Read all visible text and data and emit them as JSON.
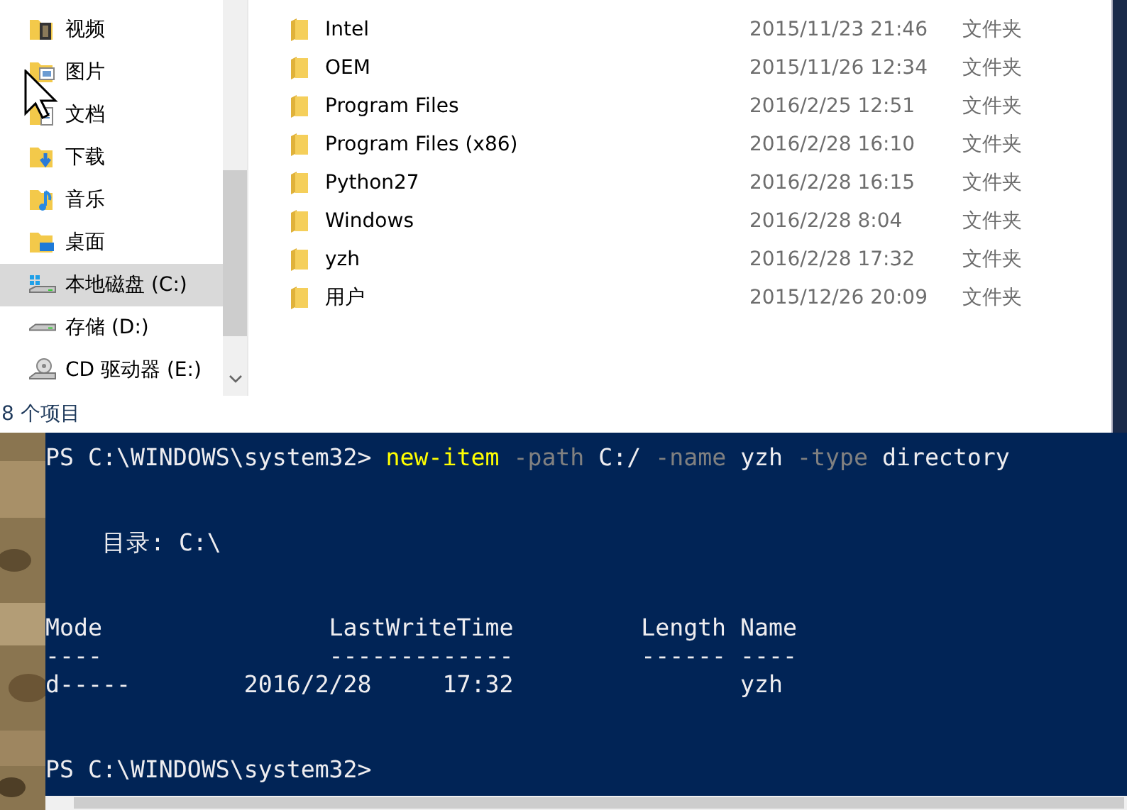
{
  "explorer": {
    "nav_items": [
      {
        "label": "视频",
        "kind": "video",
        "selected": false
      },
      {
        "label": "图片",
        "kind": "pictures",
        "selected": false
      },
      {
        "label": "文档",
        "kind": "documents",
        "selected": false
      },
      {
        "label": "下载",
        "kind": "downloads",
        "selected": false
      },
      {
        "label": "音乐",
        "kind": "music",
        "selected": false
      },
      {
        "label": "桌面",
        "kind": "desktop",
        "selected": false
      },
      {
        "label": "本地磁盘 (C:)",
        "kind": "system-drive",
        "selected": true
      },
      {
        "label": "存储 (D:)",
        "kind": "drive",
        "selected": false
      },
      {
        "label": "CD 驱动器 (E:)",
        "kind": "cd-drive",
        "selected": false
      }
    ],
    "files": [
      {
        "name": "Intel",
        "modified": "2015/11/23 21:46",
        "type": "文件夹"
      },
      {
        "name": "OEM",
        "modified": "2015/11/26 12:34",
        "type": "文件夹"
      },
      {
        "name": "Program Files",
        "modified": "2016/2/25 12:51",
        "type": "文件夹"
      },
      {
        "name": "Program Files (x86)",
        "modified": "2016/2/28 16:10",
        "type": "文件夹"
      },
      {
        "name": "Python27",
        "modified": "2016/2/28 16:15",
        "type": "文件夹"
      },
      {
        "name": "Windows",
        "modified": "2016/2/28 8:04",
        "type": "文件夹"
      },
      {
        "name": "yzh",
        "modified": "2016/2/28 17:32",
        "type": "文件夹"
      },
      {
        "name": "用户",
        "modified": "2015/12/26 20:09",
        "type": "文件夹"
      }
    ],
    "status_bar": "8 个项目"
  },
  "terminal": {
    "lines": [
      {
        "kind": "command",
        "segments": [
          {
            "kind": "prompt",
            "text": "PS C:\\WINDOWS\\system32> "
          },
          {
            "kind": "cmdlet",
            "text": "new-item"
          },
          {
            "kind": "parameter",
            "text": " -path"
          },
          {
            "kind": "plain",
            "text": " C:/ "
          },
          {
            "kind": "parameter",
            "text": "-name"
          },
          {
            "kind": "plain",
            "text": " yzh "
          },
          {
            "kind": "parameter",
            "text": "-type"
          },
          {
            "kind": "plain",
            "text": " directory"
          }
        ]
      },
      {
        "kind": "blank"
      },
      {
        "kind": "blank"
      },
      {
        "kind": "output",
        "text": "    目录: C:\\"
      },
      {
        "kind": "blank"
      },
      {
        "kind": "blank"
      },
      {
        "kind": "output",
        "text": "Mode                LastWriteTime         Length Name"
      },
      {
        "kind": "output",
        "text": "----                -------------         ------ ----"
      },
      {
        "kind": "output",
        "text": "d-----        2016/2/28     17:32                yzh"
      },
      {
        "kind": "blank"
      },
      {
        "kind": "blank"
      },
      {
        "kind": "command",
        "segments": [
          {
            "kind": "prompt",
            "text": "PS C:\\WINDOWS\\system32>"
          }
        ]
      }
    ]
  }
}
